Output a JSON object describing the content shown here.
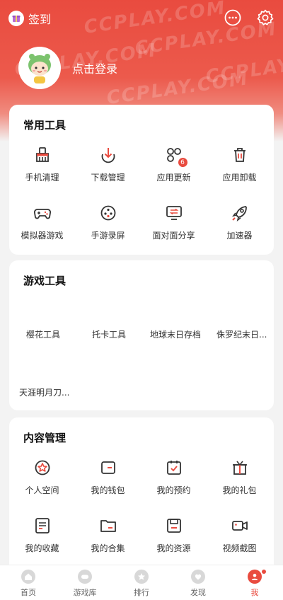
{
  "header": {
    "checkin_label": "签到",
    "login_text": "点击登录",
    "watermark": "CCPLAY.COM",
    "colors": {
      "accent": "#e94b3f"
    }
  },
  "common_tools": {
    "title": "常用工具",
    "items": [
      {
        "label": "手机清理",
        "icon": "broom-icon"
      },
      {
        "label": "下载管理",
        "icon": "download-icon"
      },
      {
        "label": "应用更新",
        "icon": "app-update-icon",
        "badge": "6"
      },
      {
        "label": "应用卸载",
        "icon": "trash-icon"
      },
      {
        "label": "模拟器游戏",
        "icon": "gamepad-icon"
      },
      {
        "label": "手游录屏",
        "icon": "film-reel-icon"
      },
      {
        "label": "面对面分享",
        "icon": "face-to-face-share-icon"
      },
      {
        "label": "加速器",
        "icon": "rocket-icon"
      }
    ]
  },
  "game_tools": {
    "title": "游戏工具",
    "items": [
      {
        "label": "樱花工具"
      },
      {
        "label": "托卡工具"
      },
      {
        "label": "地球末日存档"
      },
      {
        "label": "侏罗纪末日..."
      },
      {
        "label": "天涯明月刀..."
      }
    ]
  },
  "content_mgmt": {
    "title": "内容管理",
    "items": [
      {
        "label": "个人空间",
        "icon": "star-circle-icon"
      },
      {
        "label": "我的钱包",
        "icon": "wallet-icon"
      },
      {
        "label": "我的预约",
        "icon": "calendar-check-icon"
      },
      {
        "label": "我的礼包",
        "icon": "gift-icon"
      },
      {
        "label": "我的收藏",
        "icon": "bookmark-list-icon"
      },
      {
        "label": "我的合集",
        "icon": "folder-icon"
      },
      {
        "label": "我的资源",
        "icon": "save-icon"
      },
      {
        "label": "视频截图",
        "icon": "video-camera-icon"
      }
    ]
  },
  "bottom_nav": {
    "items": [
      {
        "label": "首页"
      },
      {
        "label": "游戏库"
      },
      {
        "label": "排行"
      },
      {
        "label": "发现"
      },
      {
        "label": "我"
      }
    ]
  }
}
